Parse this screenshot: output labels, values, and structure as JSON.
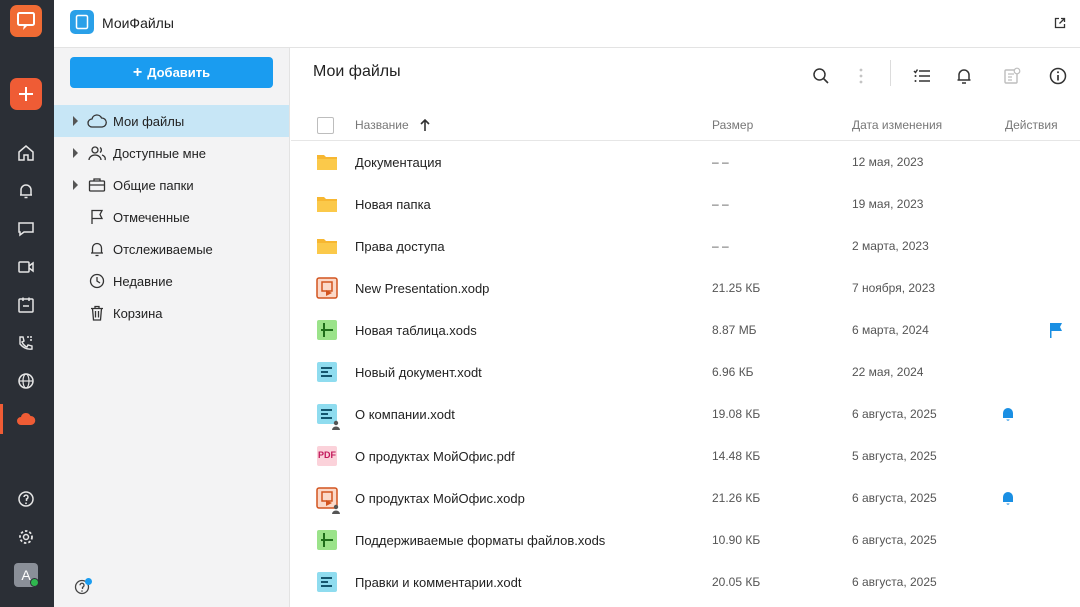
{
  "app": {
    "title": "МоиФайлы",
    "app_icon": "document-app-icon"
  },
  "colors": {
    "accent": "#1a9cf0",
    "rail": "#2b2f36",
    "brand_orange": "#ef5c35",
    "selected": "#c7e6f6"
  },
  "rail": {
    "items": [
      "home-icon",
      "bell-icon",
      "chat-icon",
      "video-icon",
      "calendar-icon",
      "phone-icon",
      "globe-icon",
      "cloud-icon"
    ],
    "active": "cloud-icon",
    "avatar": "A"
  },
  "sidebar": {
    "add_label": "Добавить",
    "items": [
      {
        "label": "Мои файлы",
        "icon": "cloud-icon",
        "active": true,
        "expandable": true
      },
      {
        "label": "Доступные мне",
        "icon": "people-icon",
        "expandable": true
      },
      {
        "label": "Общие папки",
        "icon": "briefcase-icon",
        "expandable": true
      },
      {
        "label": "Отмеченные",
        "icon": "flag-icon"
      },
      {
        "label": "Отслеживаемые",
        "icon": "bell-icon"
      },
      {
        "label": "Недавние",
        "icon": "clock-icon"
      },
      {
        "label": "Корзина",
        "icon": "trash-icon"
      }
    ]
  },
  "main": {
    "title": "Мои файлы",
    "columns": {
      "name": "Название",
      "size": "Размер",
      "date": "Дата изменения",
      "actions": "Действия"
    },
    "sort": {
      "column": "name",
      "direction": "asc"
    },
    "rows": [
      {
        "name": "Документация",
        "size": "– –",
        "date": "12 мая, 2023",
        "type": "folder"
      },
      {
        "name": "Новая папка",
        "size": "– –",
        "date": "19 мая, 2023",
        "type": "folder"
      },
      {
        "name": "Права доступа",
        "size": "– –",
        "date": "2 марта, 2023",
        "type": "folder"
      },
      {
        "name": "New Presentation.xodp",
        "size": "21.25 КБ",
        "date": "7 ноября, 2023",
        "type": "presentation"
      },
      {
        "name": "Новая таблица.xods",
        "size": "8.87 МБ",
        "date": "6 марта, 2024",
        "type": "spreadsheet",
        "action": "flag"
      },
      {
        "name": "Новый документ.xodt",
        "size": "6.96 КБ",
        "date": "22 мая, 2024",
        "type": "document"
      },
      {
        "name": "О компании.xodt",
        "size": "19.08 КБ",
        "date": "6 августа, 2025",
        "type": "document",
        "shared": true,
        "action": "bell"
      },
      {
        "name": "О продуктах МойОфис.pdf",
        "size": "14.48 КБ",
        "date": "5 августа, 2025",
        "type": "pdf",
        "type_label": "PDF"
      },
      {
        "name": "О продуктах МойОфис.xodp",
        "size": "21.26 КБ",
        "date": "6 августа, 2025",
        "type": "presentation",
        "shared": true,
        "action": "bell"
      },
      {
        "name": "Поддерживаемые форматы файлов.xods",
        "size": "10.90 КБ",
        "date": "6 августа, 2025",
        "type": "spreadsheet"
      },
      {
        "name": "Правки и комментарии.xodt",
        "size": "20.05 КБ",
        "date": "6 августа, 2025",
        "type": "document"
      }
    ]
  }
}
